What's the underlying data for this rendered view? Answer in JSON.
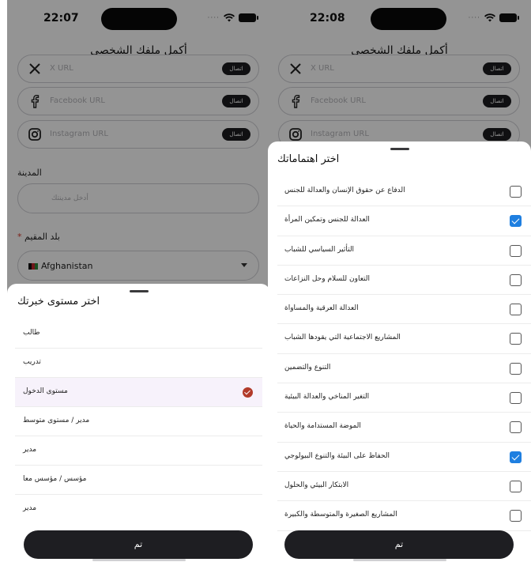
{
  "left_screen": {
    "status_bar": {
      "time": "22:07"
    },
    "title": "أكمل ملفك الشخصي",
    "social_fields": [
      {
        "name": "x",
        "icon": "x-logo-icon",
        "placeholder": "X URL",
        "connect_label": "اتصال"
      },
      {
        "name": "facebook",
        "icon": "facebook-icon",
        "placeholder": "Facebook URL",
        "connect_label": "اتصال"
      },
      {
        "name": "instagram",
        "icon": "instagram-icon",
        "placeholder": "Instagram URL",
        "connect_label": "اتصال"
      }
    ],
    "city": {
      "label": "المدينة",
      "placeholder": "أدخل مدينتك"
    },
    "country": {
      "label": "بلد المقيم",
      "required_mark": "*",
      "value": "Afghanistan"
    },
    "sheet": {
      "title": "اختر مستوى خبرتك",
      "options": [
        {
          "label": "طالب",
          "selected": false
        },
        {
          "label": "تدريب",
          "selected": false
        },
        {
          "label": "مستوى الدخول",
          "selected": true
        },
        {
          "label": "مدير / مستوى متوسط",
          "selected": false
        },
        {
          "label": "مدير",
          "selected": false
        },
        {
          "label": "مؤسس / مؤسس معا",
          "selected": false
        },
        {
          "label": "مدير",
          "selected": false
        }
      ],
      "done_label": "تم"
    }
  },
  "right_screen": {
    "status_bar": {
      "time": "22:08"
    },
    "title": "أكمل ملفك الشخصي",
    "social_fields": [
      {
        "name": "x",
        "icon": "x-logo-icon",
        "placeholder": "X URL",
        "connect_label": "اتصال"
      },
      {
        "name": "facebook",
        "icon": "facebook-icon",
        "placeholder": "Facebook URL",
        "connect_label": "اتصال"
      },
      {
        "name": "instagram",
        "icon": "instagram-icon",
        "placeholder": "Instagram URL",
        "connect_label": "اتصال"
      }
    ],
    "sheet": {
      "title": "اختر اهتماماتك",
      "options": [
        {
          "label": "الدفاع عن حقوق الإنسان والعدالة للجنس",
          "checked": false
        },
        {
          "label": "العدالة للجنس وتمكين المرأة",
          "checked": true
        },
        {
          "label": "التأثير السياسي للشباب",
          "checked": false
        },
        {
          "label": "التعاون للسلام وحل النزاعات",
          "checked": false
        },
        {
          "label": "العدالة العرقية والمساواة",
          "checked": false
        },
        {
          "label": "المشاريع الاجتماعية التي يقودها الشباب",
          "checked": false
        },
        {
          "label": "التنوع والتضمين",
          "checked": false
        },
        {
          "label": "التغير المناخي والعدالة البيئية",
          "checked": false
        },
        {
          "label": "الموضة المستدامة والحياة",
          "checked": false
        },
        {
          "label": "الحفاظ على البيئة والتنوع البيولوجي",
          "checked": true
        },
        {
          "label": "الابتكار البيئي والحلول",
          "checked": false
        },
        {
          "label": "المشاريع الصغيرة والمتوسطة والكبيرة",
          "checked": false
        }
      ],
      "done_label": "تم"
    }
  },
  "colors": {
    "selected_check": "#b23b2a",
    "checkbox_checked": "#1f7fe0",
    "primary_button": "#1e1e22"
  }
}
